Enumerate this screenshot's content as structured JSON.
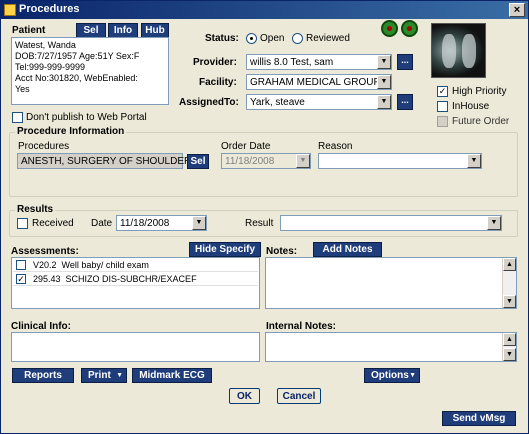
{
  "window": {
    "title": "Procedures",
    "close": "×"
  },
  "patient": {
    "label": "Patient",
    "buttons": [
      "Sel",
      "Info",
      "Hub"
    ],
    "lines": [
      "Watest, Wanda",
      "DOB:7/27/1957 Age:51Y Sex:F",
      "Tel:999-999-9999",
      "Acct No:301820, WebEnabled:",
      "Yes"
    ],
    "dont_publish_label": "Don't publish to Web Portal",
    "dont_publish_checked": false
  },
  "status": {
    "label": "Status:",
    "options": [
      "Open",
      "Reviewed"
    ],
    "selected": "Open"
  },
  "provider": {
    "label": "Provider:",
    "value": "willis 8.0 Test, sam"
  },
  "facility": {
    "label": "Facility:",
    "value": "GRAHAM MEDICAL GROUP"
  },
  "assigned_to": {
    "label": "AssignedTo:",
    "value": "Yark, steave"
  },
  "dots": "...",
  "flags": {
    "high_priority": {
      "label": "High Priority",
      "checked": true
    },
    "inhouse": {
      "label": "InHouse",
      "checked": false
    },
    "future_order": {
      "label": "Future Order",
      "checked": false
    }
  },
  "procedure_info": {
    "legend": "Procedure Information",
    "procedures_label": "Procedures",
    "procedure_value": "ANESTH, SURGERY OF SHOULDER",
    "sel": "Sel",
    "order_date_label": "Order Date",
    "order_date_value": "11/18/2008",
    "reason_label": "Reason",
    "reason_value": ""
  },
  "results": {
    "legend": "Results",
    "received_label": "Received",
    "received_checked": false,
    "date_label": "Date",
    "date_value": "11/18/2008",
    "result_label": "Result",
    "result_value": ""
  },
  "assessments": {
    "label": "Assessments:",
    "hide_specify": "Hide Specify",
    "items": [
      {
        "code": "V20.2",
        "text": "Well baby/ child exam",
        "checked": false
      },
      {
        "code": "295.43",
        "text": "SCHIZO DIS-SUBCHR/EXACEF",
        "checked": true
      }
    ]
  },
  "notes": {
    "label": "Notes:",
    "add_notes": "Add Notes",
    "value": ""
  },
  "clinical_info": {
    "label": "Clinical Info:",
    "value": ""
  },
  "internal_notes": {
    "label": "Internal Notes:",
    "value": ""
  },
  "bottom_buttons": {
    "reports": "Reports",
    "print": "Print",
    "midmark": "Midmark ECG",
    "options": "Options"
  },
  "ok": "OK",
  "cancel": "Cancel",
  "send_vmsg": "Send vMsg",
  "icons": {
    "arrow": "▼",
    "up": "▲",
    "check": "✓"
  }
}
